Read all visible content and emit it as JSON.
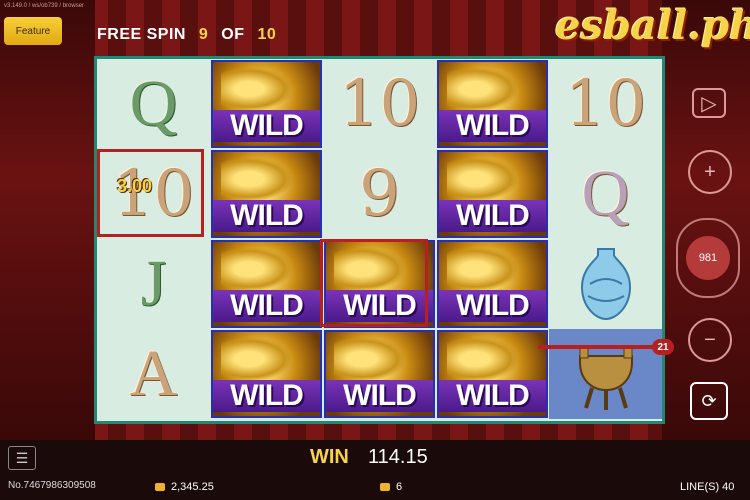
{
  "version_text": "v3.149.0 / ws/ob739 / browser",
  "feature_button": "Feature",
  "free_spin": {
    "label": "FREE SPIN",
    "current": "9",
    "of": "OF",
    "total": "10"
  },
  "logo_text": "esball.ph",
  "reels": [
    [
      "Q",
      "10",
      "J",
      "A"
    ],
    [
      "WILD",
      "WILD",
      "WILD",
      "WILD"
    ],
    [
      "10",
      "9",
      "WILD",
      "WILD"
    ],
    [
      "WILD",
      "WILD",
      "WILD",
      "WILD"
    ],
    [
      "10",
      "Q",
      "vase",
      "cauldron"
    ]
  ],
  "symbol_win_amount": "3.00",
  "payline_number": "21",
  "spin_counter": "981",
  "bottom": {
    "win_label": "WIN",
    "win_value": "114.15",
    "round_no": "No.7467986309508",
    "balance": "2,345.25",
    "bet": "6",
    "lines": "LINE(S) 40"
  },
  "colors": {
    "accent": "#f7d34a",
    "grid_border": "#1f8a74",
    "win_line": "#b62020"
  }
}
